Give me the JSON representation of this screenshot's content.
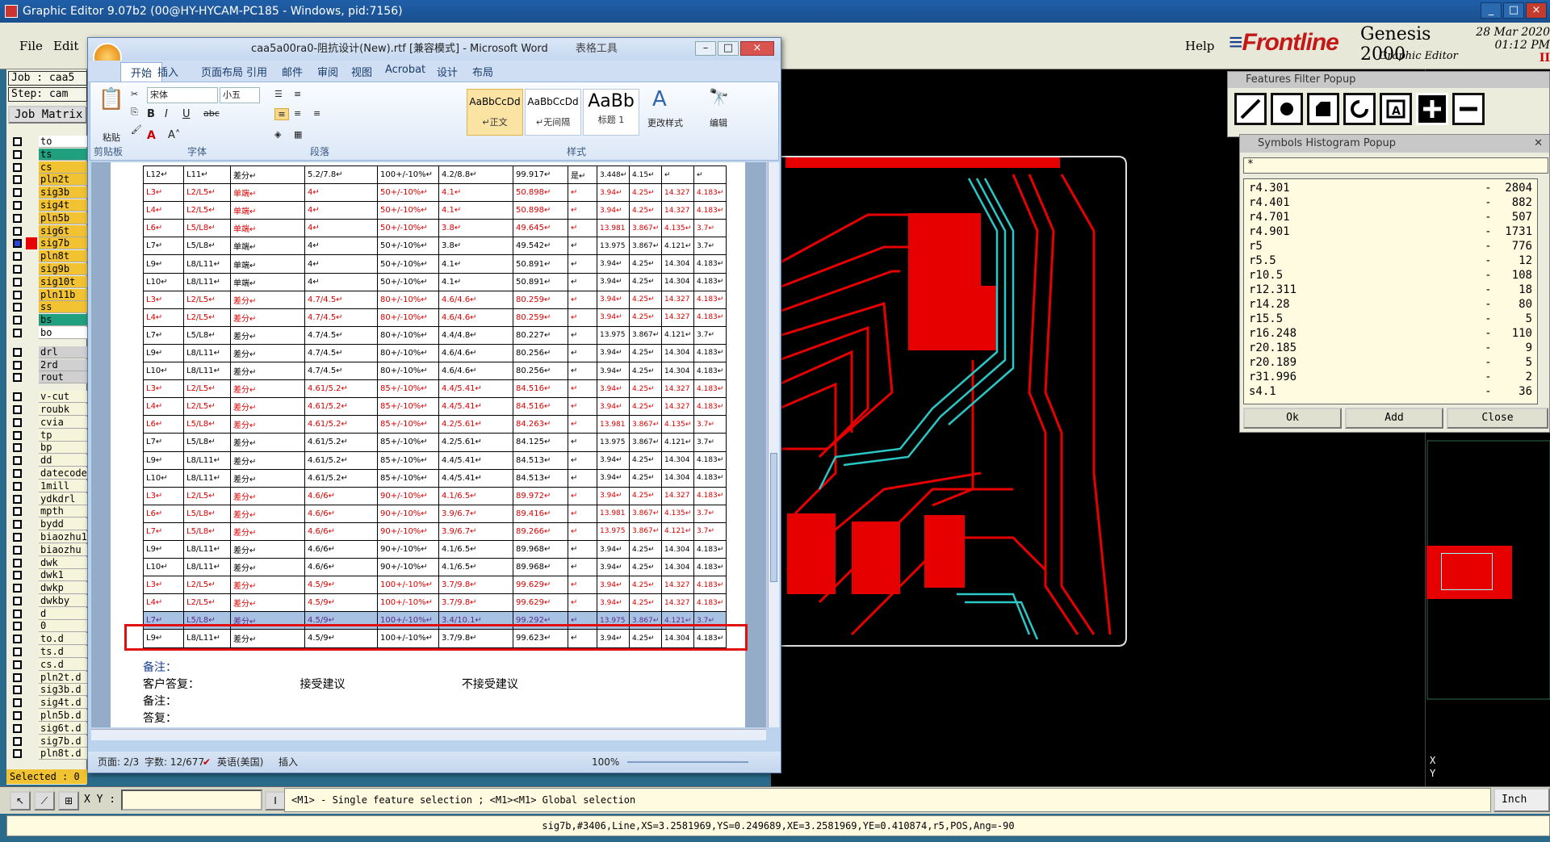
{
  "genesis": {
    "title": "Graphic Editor 9.07b2 (00@HY-HYCAM-PC185 - Windows, pid:7156)",
    "menu": {
      "file": "File",
      "edit": "Edit",
      "help": "Help"
    },
    "logo": "Frontline",
    "brand": "Genesis 2000",
    "brand_sub": "Graphic Editor",
    "date": "28 Mar 2020",
    "time": "01:12 PM",
    "job_label": "Job : caa5",
    "step_label": "Step: cam",
    "job_matrix": "Job Matrix",
    "layers": [
      {
        "name": "to",
        "color": "#ffffff"
      },
      {
        "name": "ts",
        "color": "#21a07f"
      },
      {
        "name": "cs",
        "color": "#f1c232"
      },
      {
        "name": "pln2t",
        "color": "#f1c232"
      },
      {
        "name": "sig3b",
        "color": "#f1c232"
      },
      {
        "name": "sig4t",
        "color": "#f1c232"
      },
      {
        "name": "pln5b",
        "color": "#f1c232"
      },
      {
        "name": "sig6t",
        "color": "#f1c232"
      },
      {
        "name": "sig7b",
        "color": "#f1c232"
      },
      {
        "name": "pln8t",
        "color": "#f1c232"
      },
      {
        "name": "sig9b",
        "color": "#f1c232"
      },
      {
        "name": "sig10t",
        "color": "#f1c232"
      },
      {
        "name": "pln11b",
        "color": "#f1c232"
      },
      {
        "name": "ss",
        "color": "#f1c232"
      },
      {
        "name": "bs",
        "color": "#21a07f"
      },
      {
        "name": "bo",
        "color": "#ffffff"
      },
      {
        "name": "drl",
        "color": "#d0d0d0"
      },
      {
        "name": "2rd",
        "color": "#d0d0d0"
      },
      {
        "name": "rout",
        "color": "#d0d0d0"
      },
      {
        "name": "v-cut",
        "color": "#f5f5dc"
      },
      {
        "name": "roubk",
        "color": "#f5f5dc"
      },
      {
        "name": "cvia",
        "color": "#f5f5dc"
      },
      {
        "name": "tp",
        "color": "#f5f5dc"
      },
      {
        "name": "bp",
        "color": "#f5f5dc"
      },
      {
        "name": "dd",
        "color": "#f5f5dc"
      },
      {
        "name": "datecode",
        "color": "#f5f5dc"
      },
      {
        "name": "1mill",
        "color": "#f5f5dc"
      },
      {
        "name": "ydkdrl",
        "color": "#f5f5dc"
      },
      {
        "name": "mpth",
        "color": "#f5f5dc"
      },
      {
        "name": "bydd",
        "color": "#f5f5dc"
      },
      {
        "name": "biaozhu1",
        "color": "#f5f5dc"
      },
      {
        "name": "biaozhu",
        "color": "#f5f5dc"
      },
      {
        "name": "dwk",
        "color": "#f5f5dc"
      },
      {
        "name": "dwk1",
        "color": "#f5f5dc"
      },
      {
        "name": "dwkp",
        "color": "#f5f5dc"
      },
      {
        "name": "dwkby",
        "color": "#f5f5dc"
      },
      {
        "name": "d",
        "color": "#f5f5dc"
      },
      {
        "name": "0",
        "color": "#f5f5dc"
      },
      {
        "name": "to.d",
        "color": "#f5f5dc"
      },
      {
        "name": "ts.d",
        "color": "#f5f5dc"
      },
      {
        "name": "cs.d",
        "color": "#f5f5dc"
      },
      {
        "name": "pln2t.d",
        "color": "#f5f5dc"
      },
      {
        "name": "sig3b.d",
        "color": "#f5f5dc"
      },
      {
        "name": "sig4t.d",
        "color": "#f5f5dc"
      },
      {
        "name": "pln5b.d",
        "color": "#f5f5dc"
      },
      {
        "name": "sig6t.d",
        "color": "#f5f5dc"
      },
      {
        "name": "sig7b.d",
        "color": "#f5f5dc"
      },
      {
        "name": "pln8t.d",
        "color": "#f5f5dc"
      }
    ],
    "selected": "Selected : 0",
    "xy_label": "X Y :",
    "hint": "<M1> - Single feature selection ; <M1><M1> Global selection",
    "units": "Inch",
    "status": "sig7b,#3406,Line,XS=3.2581969,YS=0.249689,XE=3.2581969,YE=0.410874,r5,POS,Ang=-90",
    "ffp_title": "Features Filter Popup",
    "shp_title": "Symbols Histogram Popup",
    "shp_filter": "*",
    "symbols": [
      {
        "sym": "r4.301",
        "count": "2804"
      },
      {
        "sym": "r4.401",
        "count": "882"
      },
      {
        "sym": "r4.701",
        "count": "507"
      },
      {
        "sym": "r4.901",
        "count": "1731"
      },
      {
        "sym": "r5",
        "count": "776"
      },
      {
        "sym": "r5.5",
        "count": "12"
      },
      {
        "sym": "r10.5",
        "count": "108"
      },
      {
        "sym": "r12.311",
        "count": "18"
      },
      {
        "sym": "r14.28",
        "count": "80"
      },
      {
        "sym": "r15.5",
        "count": "5"
      },
      {
        "sym": "r16.248",
        "count": "110"
      },
      {
        "sym": "r20.185",
        "count": "9"
      },
      {
        "sym": "r20.189",
        "count": "5"
      },
      {
        "sym": "r31.996",
        "count": "2"
      },
      {
        "sym": "s4.1",
        "count": "36"
      }
    ],
    "ok": "Ok",
    "add": "Add",
    "close": "Close",
    "coord_x": "X",
    "coord_y": "Y"
  },
  "word": {
    "title": "caa5a00ra0-阻抗设计(New).rtf [兼容模式] - Microsoft Word",
    "context_tab": "表格工具",
    "tabs": [
      "开始",
      "插入",
      "页面布局",
      "引用",
      "邮件",
      "审阅",
      "视图",
      "Acrobat",
      "设计",
      "布局"
    ],
    "font_name": "宋体",
    "font_size": "小五",
    "groups": {
      "clipboard": "剪贴板",
      "font": "字体",
      "paragraph": "段落",
      "styles": "样式"
    },
    "paste": "粘贴",
    "change_styles": "更改样式",
    "edit": "编辑",
    "styles": [
      {
        "preview": "AaBbCcDd",
        "name": "↵正文"
      },
      {
        "preview": "AaBbCcDd",
        "name": "↵无间隔"
      },
      {
        "preview": "AaBb",
        "name": "标题 1"
      }
    ],
    "rows": [
      {
        "c": [
          "L12↵",
          "L11↵",
          "差分↵",
          "5.2/7.8↵",
          "100+/-10%↵",
          "4.2/8.8↵",
          "99.917↵",
          "是↵",
          "3.448↵",
          "4.15↵",
          "↵",
          "↵"
        ],
        "red": false
      },
      {
        "c": [
          "L3↵",
          "L2/L5↵",
          "单端↵",
          "4↵",
          "50+/-10%↵",
          "4.1↵",
          "50.898↵",
          "↵",
          "3.94↵",
          "4.25↵",
          "14.327",
          "4.183↵"
        ],
        "red": true
      },
      {
        "c": [
          "L4↵",
          "L2/L5↵",
          "单端↵",
          "4↵",
          "50+/-10%↵",
          "4.1↵",
          "50.898↵",
          "↵",
          "3.94↵",
          "4.25↵",
          "14.327",
          "4.183↵"
        ],
        "red": true
      },
      {
        "c": [
          "L6↵",
          "L5/L8↵",
          "单端↵",
          "4↵",
          "50+/-10%↵",
          "3.8↵",
          "49.645↵",
          "↵",
          "13.981",
          "3.867↵",
          "4.135↵",
          "3.7↵"
        ],
        "red": true
      },
      {
        "c": [
          "L7↵",
          "L5/L8↵",
          "单端↵",
          "4↵",
          "50+/-10%↵",
          "3.8↵",
          "49.542↵",
          "↵",
          "13.975",
          "3.867↵",
          "4.121↵",
          "3.7↵"
        ],
        "red": false
      },
      {
        "c": [
          "L9↵",
          "L8/L11↵",
          "单端↵",
          "4↵",
          "50+/-10%↵",
          "4.1↵",
          "50.891↵",
          "↵",
          "3.94↵",
          "4.25↵",
          "14.304",
          "4.183↵"
        ],
        "red": false
      },
      {
        "c": [
          "L10↵",
          "L8/L11↵",
          "单端↵",
          "4↵",
          "50+/-10%↵",
          "4.1↵",
          "50.891↵",
          "↵",
          "3.94↵",
          "4.25↵",
          "14.304",
          "4.183↵"
        ],
        "red": false
      },
      {
        "c": [
          "L3↵",
          "L2/L5↵",
          "差分↵",
          "4.7/4.5↵",
          "80+/-10%↵",
          "4.6/4.6↵",
          "80.259↵",
          "↵",
          "3.94↵",
          "4.25↵",
          "14.327",
          "4.183↵"
        ],
        "red": true
      },
      {
        "c": [
          "L4↵",
          "L2/L5↵",
          "差分↵",
          "4.7/4.5↵",
          "80+/-10%↵",
          "4.6/4.6↵",
          "80.259↵",
          "↵",
          "3.94↵",
          "4.25↵",
          "14.327",
          "4.183↵"
        ],
        "red": true
      },
      {
        "c": [
          "L7↵",
          "L5/L8↵",
          "差分↵",
          "4.7/4.5↵",
          "80+/-10%↵",
          "4.4/4.8↵",
          "80.227↵",
          "↵",
          "13.975",
          "3.867↵",
          "4.121↵",
          "3.7↵"
        ],
        "red": false
      },
      {
        "c": [
          "L9↵",
          "L8/L11↵",
          "差分↵",
          "4.7/4.5↵",
          "80+/-10%↵",
          "4.6/4.6↵",
          "80.256↵",
          "↵",
          "3.94↵",
          "4.25↵",
          "14.304",
          "4.183↵"
        ],
        "red": false
      },
      {
        "c": [
          "L10↵",
          "L8/L11↵",
          "差分↵",
          "4.7/4.5↵",
          "80+/-10%↵",
          "4.6/4.6↵",
          "80.256↵",
          "↵",
          "3.94↵",
          "4.25↵",
          "14.304",
          "4.183↵"
        ],
        "red": false
      },
      {
        "c": [
          "L3↵",
          "L2/L5↵",
          "差分↵",
          "4.61/5.2↵",
          "85+/-10%↵",
          "4.4/5.41↵",
          "84.516↵",
          "↵",
          "3.94↵",
          "4.25↵",
          "14.327",
          "4.183↵"
        ],
        "red": true
      },
      {
        "c": [
          "L4↵",
          "L2/L5↵",
          "差分↵",
          "4.61/5.2↵",
          "85+/-10%↵",
          "4.4/5.41↵",
          "84.516↵",
          "↵",
          "3.94↵",
          "4.25↵",
          "14.327",
          "4.183↵"
        ],
        "red": true
      },
      {
        "c": [
          "L6↵",
          "L5/L8↵",
          "差分↵",
          "4.61/5.2↵",
          "85+/-10%↵",
          "4.2/5.61↵",
          "84.263↵",
          "↵",
          "13.981",
          "3.867↵",
          "4.135↵",
          "3.7↵"
        ],
        "red": true
      },
      {
        "c": [
          "L7↵",
          "L5/L8↵",
          "差分↵",
          "4.61/5.2↵",
          "85+/-10%↵",
          "4.2/5.61↵",
          "84.125↵",
          "↵",
          "13.975",
          "3.867↵",
          "4.121↵",
          "3.7↵"
        ],
        "red": false
      },
      {
        "c": [
          "L9↵",
          "L8/L11↵",
          "差分↵",
          "4.61/5.2↵",
          "85+/-10%↵",
          "4.4/5.41↵",
          "84.513↵",
          "↵",
          "3.94↵",
          "4.25↵",
          "14.304",
          "4.183↵"
        ],
        "red": false
      },
      {
        "c": [
          "L10↵",
          "L8/L11↵",
          "差分↵",
          "4.61/5.2↵",
          "85+/-10%↵",
          "4.4/5.41↵",
          "84.513↵",
          "↵",
          "3.94↵",
          "4.25↵",
          "14.304",
          "4.183↵"
        ],
        "red": false
      },
      {
        "c": [
          "L3↵",
          "L2/L5↵",
          "差分↵",
          "4.6/6↵",
          "90+/-10%↵",
          "4.1/6.5↵",
          "89.972↵",
          "↵",
          "3.94↵",
          "4.25↵",
          "14.327",
          "4.183↵"
        ],
        "red": true
      },
      {
        "c": [
          "L6↵",
          "L5/L8↵",
          "差分↵",
          "4.6/6↵",
          "90+/-10%↵",
          "3.9/6.7↵",
          "89.416↵",
          "↵",
          "13.981",
          "3.867↵",
          "4.135↵",
          "3.7↵"
        ],
        "red": true
      },
      {
        "c": [
          "L7↵",
          "L5/L8↵",
          "差分↵",
          "4.6/6↵",
          "90+/-10%↵",
          "3.9/6.7↵",
          "89.266↵",
          "↵",
          "13.975",
          "3.867↵",
          "4.121↵",
          "3.7↵"
        ],
        "red": true
      },
      {
        "c": [
          "L9↵",
          "L8/L11↵",
          "差分↵",
          "4.6/6↵",
          "90+/-10%↵",
          "4.1/6.5↵",
          "89.968↵",
          "↵",
          "3.94↵",
          "4.25↵",
          "14.304",
          "4.183↵"
        ],
        "red": false
      },
      {
        "c": [
          "L10↵",
          "L8/L11↵",
          "差分↵",
          "4.6/6↵",
          "90+/-10%↵",
          "4.1/6.5↵",
          "89.968↵",
          "↵",
          "3.94↵",
          "4.25↵",
          "14.304",
          "4.183↵"
        ],
        "red": false
      },
      {
        "c": [
          "L3↵",
          "L2/L5↵",
          "差分↵",
          "4.5/9↵",
          "100+/-10%↵",
          "3.7/9.8↵",
          "99.629↵",
          "↵",
          "3.94↵",
          "4.25↵",
          "14.327",
          "4.183↵"
        ],
        "red": true
      },
      {
        "c": [
          "L4↵",
          "L2/L5↵",
          "差分↵",
          "4.5/9↵",
          "100+/-10%↵",
          "3.7/9.8↵",
          "99.629↵",
          "↵",
          "3.94↵",
          "4.25↵",
          "14.327",
          "4.183↵"
        ],
        "red": true
      },
      {
        "c": [
          "L7↵",
          "L5/L8↵",
          "差分↵",
          "4.5/9↵",
          "100+/-10%↵",
          "3.4/10.1↵",
          "99.292↵",
          "↵",
          "13.975",
          "3.867↵",
          "4.121↵",
          "3.7↵"
        ],
        "red": false,
        "hl": true
      },
      {
        "c": [
          "L9↵",
          "L8/L11↵",
          "差分↵",
          "4.5/9↵",
          "100+/-10%↵",
          "3.7/9.8↵",
          "99.623↵",
          "↵",
          "3.94↵",
          "4.25↵",
          "14.304",
          "4.183↵"
        ],
        "red": false
      }
    ],
    "notes": {
      "n1": "备注：",
      "reply": "客户答复：",
      "accept": "接受建议",
      "reject": "不接受建议",
      "n2": "备注：",
      "ans": "答复："
    },
    "status": {
      "page": "页面: 2/3",
      "words": "字数: 12/677",
      "lang": "英语(美国)",
      "mode": "插入",
      "zoom": "100%"
    }
  }
}
